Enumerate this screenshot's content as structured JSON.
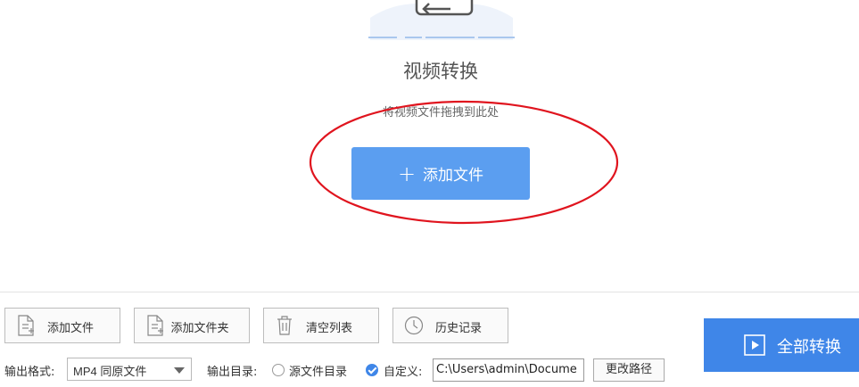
{
  "hero": {
    "title": "视频转换",
    "subtitle": "将视频文件拖拽到此处",
    "add_button_label": "添加文件",
    "add_button_icon": "plus-icon"
  },
  "toolbar": {
    "buttons": [
      {
        "label": "添加文件",
        "icon": "file-add-icon"
      },
      {
        "label": "添加文件夹",
        "icon": "folder-add-icon"
      },
      {
        "label": "清空列表",
        "icon": "trash-icon"
      },
      {
        "label": "历史记录",
        "icon": "clock-icon"
      }
    ],
    "convert_all_label": "全部转换",
    "convert_all_icon": "play-icon"
  },
  "settings": {
    "format_label": "输出格式:",
    "format_value": "MP4 同原文件",
    "output_dir_label": "输出目录:",
    "option_source_label": "源文件目录",
    "option_source_checked": false,
    "option_custom_label": "自定义:",
    "option_custom_checked": true,
    "path_value": "C:\\Users\\admin\\Docume",
    "change_path_label": "更改路径"
  },
  "colors": {
    "primary_button": "#5b9ef0",
    "convert_button": "#3f86e8",
    "annotation_circle": "#e0141e"
  }
}
